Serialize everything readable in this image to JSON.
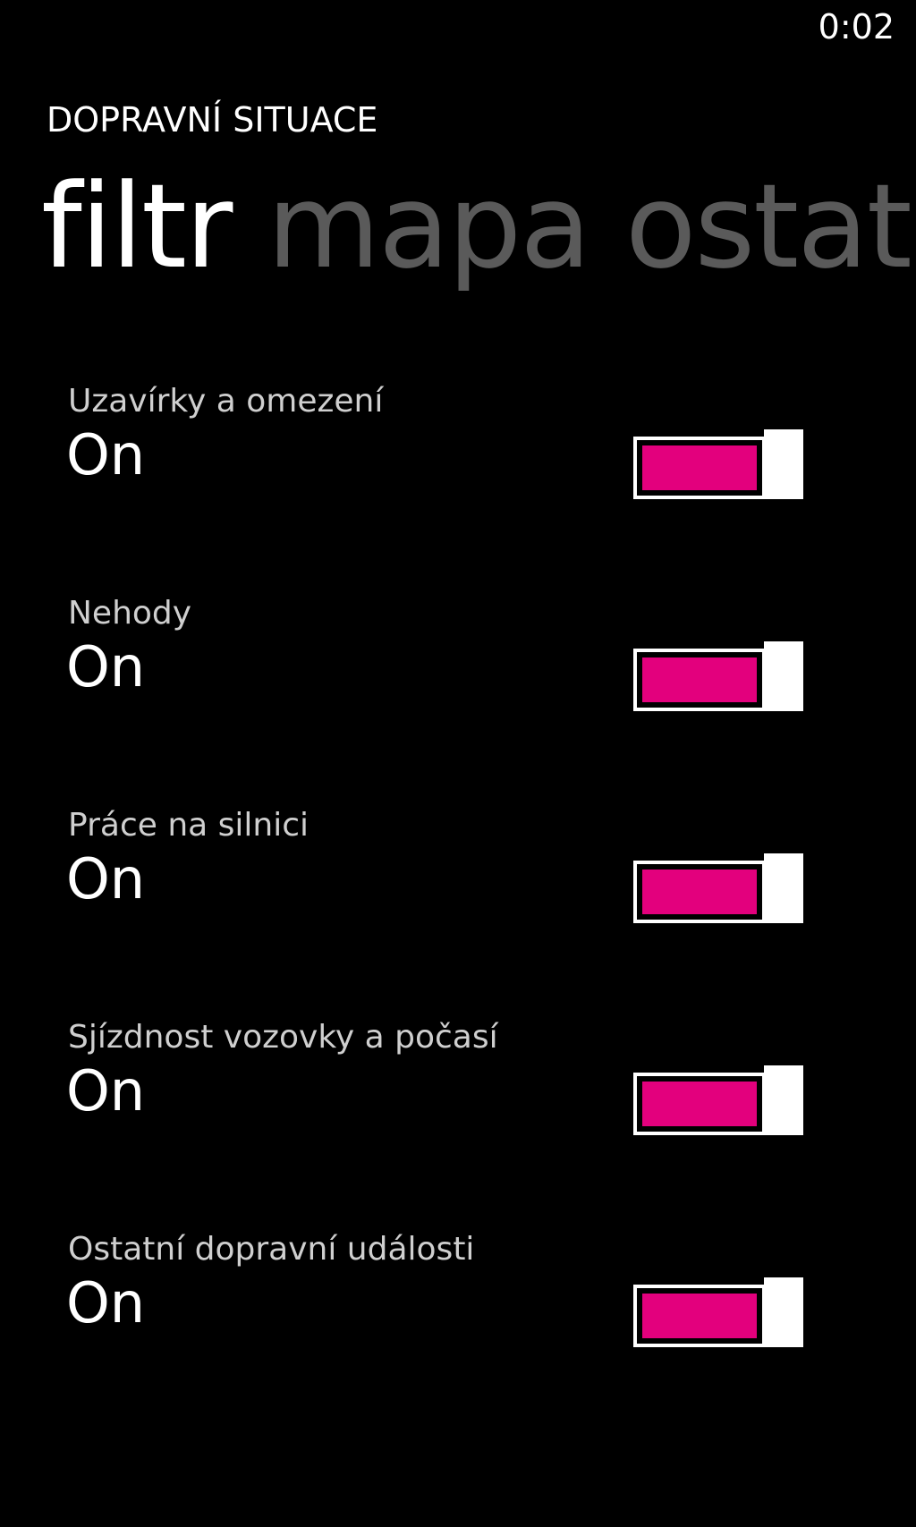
{
  "status_bar": {
    "time": "0:02"
  },
  "app": {
    "title": "DOPRAVNÍ SITUACE"
  },
  "pivot": {
    "tabs": [
      {
        "label": "filtr",
        "active": true
      },
      {
        "label": "mapa",
        "active": false
      },
      {
        "label": "ostat",
        "active": false
      }
    ]
  },
  "settings": [
    {
      "label": "Uzavírky a omezení",
      "state": "On",
      "enabled": true
    },
    {
      "label": "Nehody",
      "state": "On",
      "enabled": true
    },
    {
      "label": "Práce na silnici",
      "state": "On",
      "enabled": true
    },
    {
      "label": "Sjízdnost vozovky a počasí",
      "state": "On",
      "enabled": true
    },
    {
      "label": "Ostatní dopravní události",
      "state": "On",
      "enabled": true
    }
  ],
  "colors": {
    "accent": "#e3007d",
    "background": "#000000",
    "inactive_tab": "#5a5a5a"
  }
}
